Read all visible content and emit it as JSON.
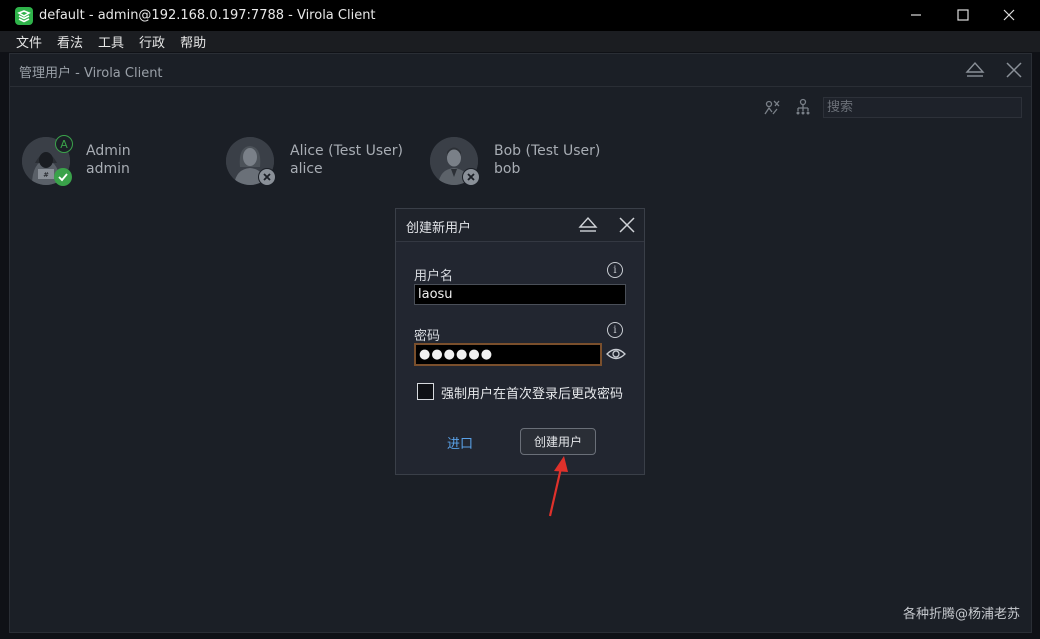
{
  "window": {
    "title": "default - admin@192.168.0.197:7788 - Virola Client",
    "icons": {
      "logo": "virola-logo-icon",
      "minimize": "minimize-icon",
      "maximize": "maximize-icon",
      "close": "close-icon"
    }
  },
  "menubar": {
    "items": [
      {
        "label": "文件"
      },
      {
        "label": "看法"
      },
      {
        "label": "工具"
      },
      {
        "label": "行政"
      },
      {
        "label": "帮助"
      }
    ]
  },
  "panel": {
    "title": "管理用户 - Virola Client",
    "search_placeholder": "搜索",
    "icons": {
      "eject": "eject-icon",
      "close": "close-icon",
      "toolbar_1": "user-disconnect-icon",
      "toolbar_2": "user-tree-icon"
    }
  },
  "users": [
    {
      "display_name": "Admin",
      "login": "admin",
      "badge_letter": "A",
      "status": "active",
      "status_icon": "check-badge-icon"
    },
    {
      "display_name": "Alice (Test User)",
      "login": "alice",
      "status": "disabled",
      "status_icon": "x-badge-icon"
    },
    {
      "display_name": "Bob (Test User)",
      "login": "bob",
      "status": "disabled",
      "status_icon": "x-badge-icon"
    }
  ],
  "dialog": {
    "title": "创建新用户",
    "username_label": "用户名",
    "username_value": "laosu",
    "password_label": "密码",
    "password_value": "●●●●●●",
    "force_change_label": "强制用户在首次登录后更改密码",
    "force_change_checked": false,
    "import_label": "进口",
    "create_label": "创建用户",
    "icons": {
      "eject": "eject-icon",
      "close": "close-icon",
      "info": "info-icon",
      "show_password": "eye-icon"
    }
  },
  "annotation": {
    "arrow_color": "#e0312b"
  },
  "watermark": "各种折腾@杨浦老苏",
  "colors": {
    "accent_link": "#5aa2e8",
    "active_badge": "#3aa24a",
    "background": "#1b1f26"
  }
}
